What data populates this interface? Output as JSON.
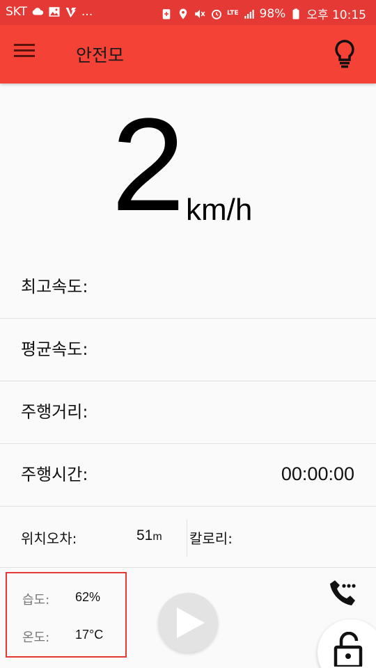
{
  "status_bar": {
    "carrier": "SKT",
    "overflow": "...",
    "battery": "98%",
    "time": "오후 10:15",
    "network": "LTE",
    "icons_left": [
      "cloud-icon",
      "image-icon",
      "app-notification-icon"
    ],
    "icons_right": [
      "battery-saver-icon",
      "location-icon",
      "mute-icon",
      "alarm-icon",
      "lte-icon",
      "signal-icon",
      "battery-icon"
    ]
  },
  "app_bar": {
    "title": "안전모",
    "menu_icon": "hamburger-menu-icon",
    "action_icon": "lightbulb-icon"
  },
  "speed": {
    "value": "2",
    "unit": "km/h"
  },
  "stats": [
    {
      "label": "최고속도:",
      "value": ""
    },
    {
      "label": "평균속도:",
      "value": ""
    },
    {
      "label": "주행거리:",
      "value": ""
    },
    {
      "label": "주행시간:",
      "value": "00:00:00"
    }
  ],
  "info": {
    "position_error_label": "위치오차:",
    "position_error_value": "51",
    "position_error_unit": "m",
    "calorie_label": "칼로리:"
  },
  "environment": {
    "humidity_label": "습도:",
    "humidity_value": "62%",
    "temperature_label": "온도:",
    "temperature_value": "17°C"
  },
  "controls": {
    "play_icon": "play-icon",
    "phone_icon": "phone-icon",
    "lock_icon": "unlock-icon"
  },
  "colors": {
    "status_bar": "#e53935",
    "app_bar": "#f44336",
    "highlight_border": "#e53935"
  }
}
